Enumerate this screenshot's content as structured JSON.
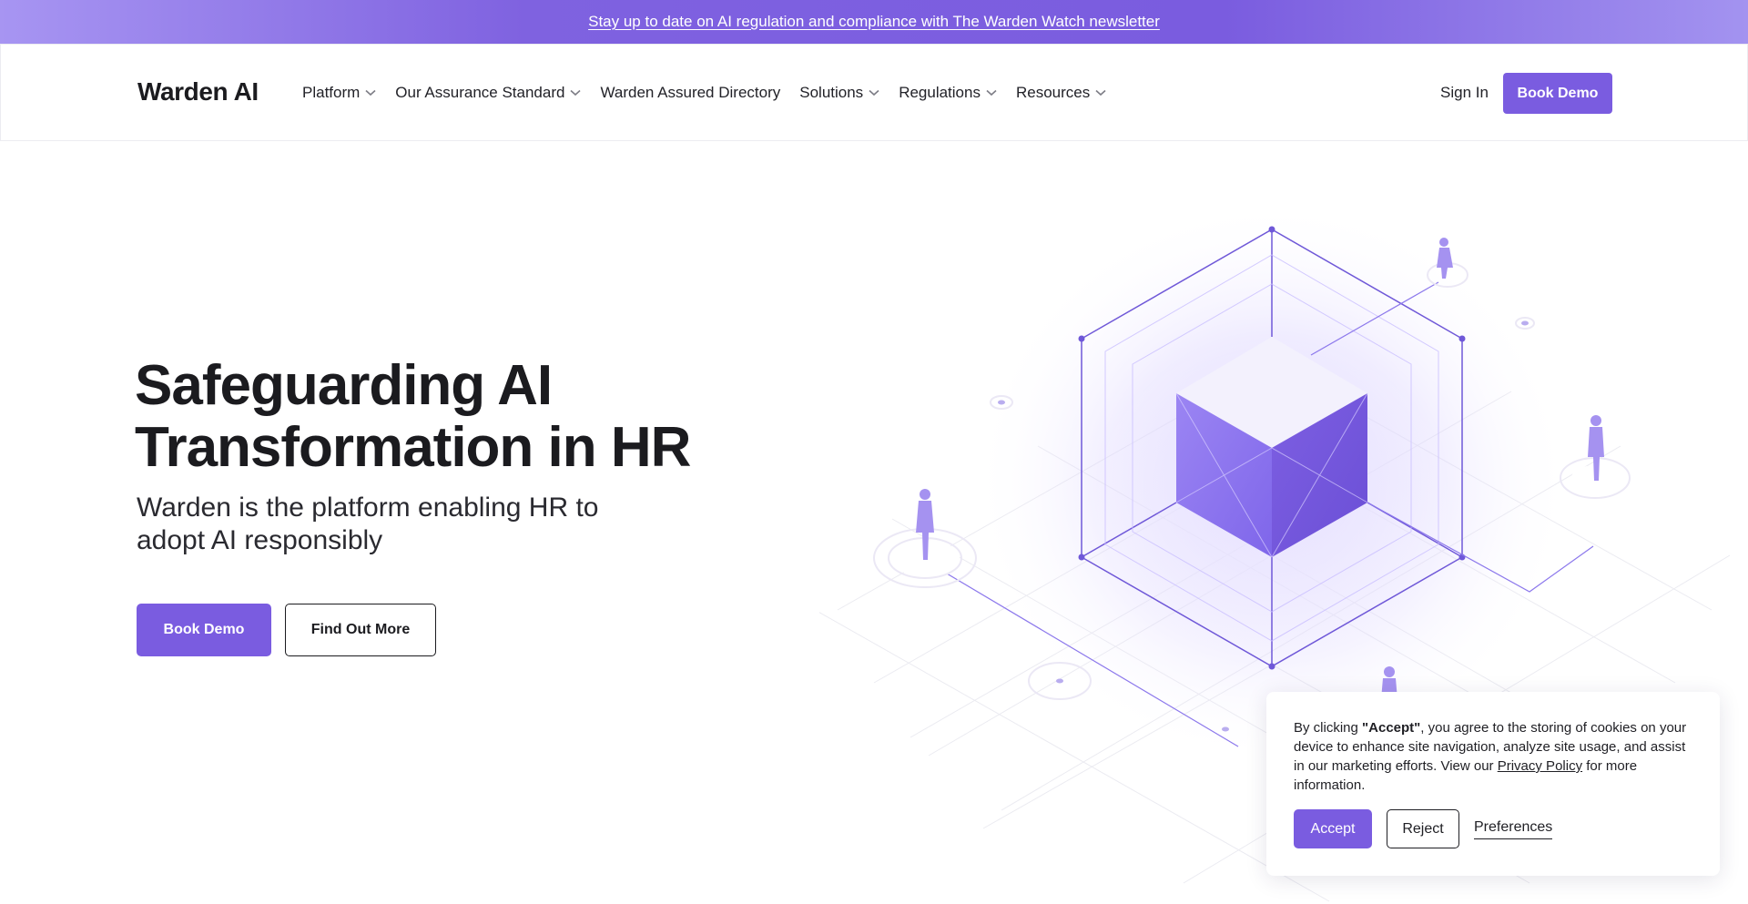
{
  "announcement": {
    "text": "Stay up to date on AI regulation and compliance with The Warden Watch newsletter"
  },
  "nav": {
    "logo": "Warden AI",
    "items": [
      {
        "label": "Platform",
        "has_dropdown": true
      },
      {
        "label": "Our Assurance Standard",
        "has_dropdown": true
      },
      {
        "label": "Warden Assured Directory",
        "has_dropdown": false
      },
      {
        "label": "Solutions",
        "has_dropdown": true
      },
      {
        "label": "Regulations",
        "has_dropdown": true
      },
      {
        "label": "Resources",
        "has_dropdown": true
      }
    ],
    "sign_in": "Sign In",
    "cta": "Book Demo"
  },
  "hero": {
    "title_line1": "Safeguarding AI",
    "title_line2": "Transformation in HR",
    "subtitle": "Warden is the platform enabling HR to adopt AI responsibly",
    "primary_button": "Book Demo",
    "secondary_button": "Find Out More"
  },
  "cookie": {
    "text_before": "By clicking ",
    "text_bold": "\"Accept\"",
    "text_after": ", you agree to the storing of cookies on your device to enhance site navigation, analyze site usage, and assist in our marketing efforts. View our ",
    "link_text": "Privacy Policy",
    "text_end": " for more information.",
    "accept": "Accept",
    "reject": "Reject",
    "preferences": "Preferences"
  },
  "colors": {
    "brand": "#7a5ce0",
    "text": "#1b1b1f",
    "banner_start": "#a795f2",
    "banner_end": "#7a5cdf"
  },
  "icons": [
    "chevron-down-icon",
    "person-figure-icon",
    "cube-illustration"
  ]
}
